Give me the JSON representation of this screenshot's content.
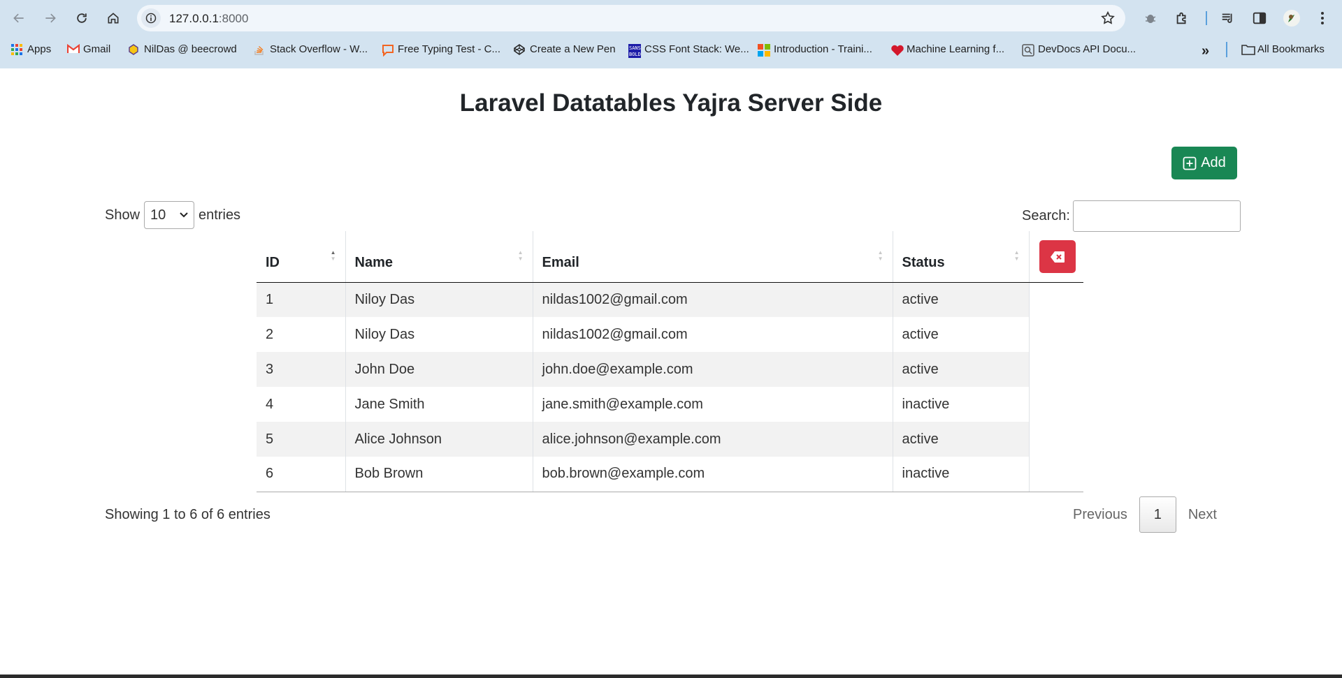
{
  "browser": {
    "url_host": "127.0.0.1",
    "url_port": ":8000",
    "bookmarks": [
      {
        "label": "Apps",
        "icon": "apps-grid-icon"
      },
      {
        "label": "Gmail",
        "icon": "gmail-icon"
      },
      {
        "label": "NilDas @ beecrowd",
        "icon": "beecrowd-icon"
      },
      {
        "label": "Stack Overflow - W...",
        "icon": "stackoverflow-icon"
      },
      {
        "label": "Free Typing Test - C...",
        "icon": "chat-bubble-icon"
      },
      {
        "label": "Create a New Pen",
        "icon": "codepen-icon"
      },
      {
        "label": "CSS Font Stack: We...",
        "icon": "cssfontstack-icon"
      },
      {
        "label": "Introduction - Traini...",
        "icon": "microsoft-icon"
      },
      {
        "label": "Machine Learning f...",
        "icon": "heart-icon"
      },
      {
        "label": "DevDocs API Docu...",
        "icon": "devdocs-icon"
      }
    ],
    "more_bookmarks": "»",
    "all_bookmarks": "All Bookmarks"
  },
  "page": {
    "title": "Laravel Datatables Yajra Server Side",
    "add_label": "Add",
    "show_label": "Show",
    "entries_label": "entries",
    "page_length": "10",
    "search_label": "Search:",
    "search_value": ""
  },
  "table": {
    "columns": [
      "ID",
      "Name",
      "Email",
      "Status"
    ],
    "rows": [
      {
        "id": "1",
        "name": "Niloy Das",
        "email": "nildas1002@gmail.com",
        "status": "active"
      },
      {
        "id": "2",
        "name": "Niloy Das",
        "email": "nildas1002@gmail.com",
        "status": "active"
      },
      {
        "id": "3",
        "name": "John Doe",
        "email": "john.doe@example.com",
        "status": "active"
      },
      {
        "id": "4",
        "name": "Jane Smith",
        "email": "jane.smith@example.com",
        "status": "inactive"
      },
      {
        "id": "5",
        "name": "Alice Johnson",
        "email": "alice.johnson@example.com",
        "status": "active"
      },
      {
        "id": "6",
        "name": "Bob Brown",
        "email": "bob.brown@example.com",
        "status": "inactive"
      }
    ]
  },
  "footer": {
    "info": "Showing 1 to 6 of 6 entries",
    "previous": "Previous",
    "current_page": "1",
    "next": "Next"
  },
  "colors": {
    "add_button": "#198754",
    "delete_button": "#dc3545",
    "chrome_bg": "#d3e3f0"
  }
}
